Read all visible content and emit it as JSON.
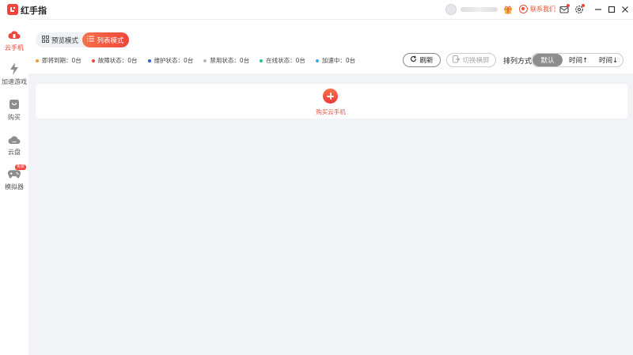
{
  "app": {
    "title": "红手指"
  },
  "titlebar": {
    "contact_label": "联系我们"
  },
  "sidebar": {
    "items": [
      {
        "label": "云手机",
        "icon": "cloud-phone-icon",
        "active": true
      },
      {
        "label": "加速游戏",
        "icon": "lightning-icon",
        "active": false
      },
      {
        "label": "购买",
        "icon": "shopping-bag-icon",
        "active": false
      },
      {
        "label": "云盘",
        "icon": "cloud-disk-icon",
        "active": false
      },
      {
        "label": "模拟器",
        "icon": "gamepad-icon",
        "active": false,
        "badge": "免费"
      }
    ]
  },
  "view_mode": {
    "preview_label": "预览模式",
    "list_label": "列表模式",
    "selected": "列表模式"
  },
  "status": [
    {
      "label": "即将到期：0台",
      "color": "#f39a2b"
    },
    {
      "label": "故障状态：0台",
      "color": "#f0453a"
    },
    {
      "label": "维护状态：0台",
      "color": "#2f5fd0"
    },
    {
      "label": "禁用状态：0台",
      "color": "#b9b9b9"
    },
    {
      "label": "在线状态：0台",
      "color": "#2fbf8f"
    },
    {
      "label": "加速中：0台",
      "color": "#3ba9e6"
    }
  ],
  "toolbar": {
    "refresh_label": "刷新",
    "switch_label": "切换横屏"
  },
  "sort": {
    "label": "排列方式",
    "options": [
      "默认",
      "时间↑",
      "时间↓"
    ],
    "selected": "默认"
  },
  "main": {
    "buy_label": "购买云手机"
  },
  "colors": {
    "accent": "#f0453a",
    "accent_gradient_start": "#f5714a",
    "background": "#f2f3f7"
  }
}
